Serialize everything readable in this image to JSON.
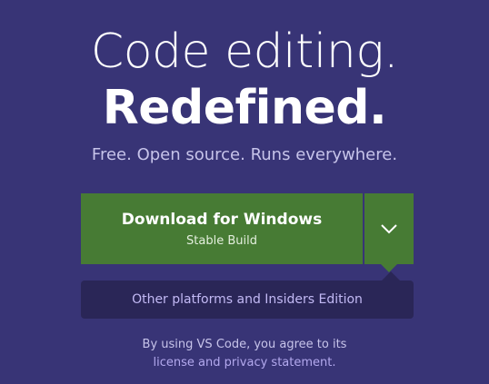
{
  "hero": {
    "headline_line1": "Code editing.",
    "headline_line2": "Redefined.",
    "subtitle": "Free. Open source. Runs everywhere."
  },
  "download": {
    "title": "Download for Windows",
    "subtitle": "Stable Build",
    "toggle_icon": "chevron-down-icon",
    "accent_color": "#477b34"
  },
  "dropdown": {
    "link_label": "Other platforms and Insiders Edition"
  },
  "terms": {
    "text": "By using VS Code, you agree to its",
    "link_label": "license and privacy statement."
  },
  "colors": {
    "background": "#383476",
    "panel": "#2a2657",
    "link": "#b3a9ee"
  }
}
